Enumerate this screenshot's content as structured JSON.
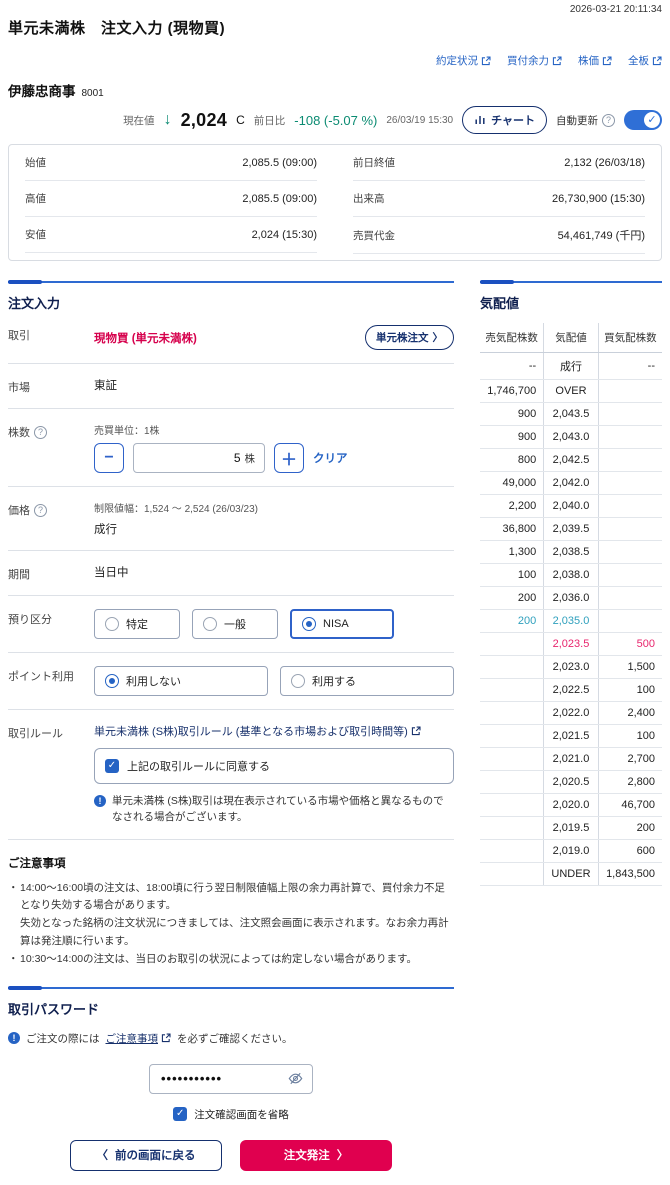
{
  "colors": {
    "accent_blue": "#2e6ad1",
    "link_blue": "#2563c4",
    "navy": "#15306e",
    "crimson": "#d6004c",
    "button_red": "#e0004f",
    "down_green": "#0b8b72",
    "sell_teal": "#2fa0bd",
    "buy_pink": "#e8256d",
    "toggle_blue": "#2f6fd6"
  },
  "header": {
    "timestamp": "2026-03-21 20:11:34",
    "title": "単元未満株　注文入力 (現物買)",
    "links": {
      "executions": "約定状況",
      "buying_power": "買付余力",
      "stock_price": "株価",
      "full_board": "全板"
    }
  },
  "stock": {
    "name": "伊藤忠商事",
    "code": "8001",
    "current_label": "現在値",
    "down_arrow": "↓",
    "price": "2,024",
    "price_flag": "C",
    "change_label": "前日比",
    "change": "-108 (-5.07 %)",
    "quote_time": "26/03/19 15:30",
    "chart_button": "チャート",
    "auto_update": "自動更新",
    "toggle_check": "✓"
  },
  "summary": {
    "open_label": "始値",
    "open": "2,085.5 (09:00)",
    "high_label": "高値",
    "high": "2,085.5 (09:00)",
    "low_label": "安値",
    "low": "2,024 (15:30)",
    "prev_close_label": "前日終値",
    "prev_close": "2,132 (26/03/18)",
    "volume_label": "出来高",
    "volume": "26,730,900 (15:30)",
    "turnover_label": "売買代金",
    "turnover": "54,461,749 (千円)"
  },
  "order": {
    "title": "注文入力",
    "trade_label": "取引",
    "trade_value": "現物買 (単元未満株)",
    "unit_order_button": "単元株注文",
    "market_label": "市場",
    "market_value": "東証",
    "qty_label": "株数",
    "unit_note": "売買単位：1株",
    "minus": "−",
    "plus": "＋",
    "qty": "5",
    "qty_unit": "株",
    "clear": "クリア",
    "price_label": "価格",
    "limit_note": "制限値幅：1,524 ～ 2,524 (26/03/23)",
    "price_value": "成行",
    "period_label": "期間",
    "period_value": "当日中",
    "account_label": "預り区分",
    "account_options": [
      "特定",
      "一般",
      "NISA"
    ],
    "account_selected": "NISA",
    "point_label": "ポイント利用",
    "point_options": [
      "利用しない",
      "利用する"
    ],
    "point_selected": "利用しない",
    "rule_label": "取引ルール",
    "rule_link": "単元未満株 (S株)取引ルール (基準となる市場および取引時間等)",
    "agree_check": "✓",
    "rule_agree": "上記の取引ルールに同意する",
    "info_mark": "!",
    "rule_note": "単元未満株 (S株)取引は現在表示されている市場や価格と異なるものでなされる場合がございます。"
  },
  "notes": {
    "title": "ご注意事項",
    "items": [
      "14:00～16:00頃の注文は、18:00頃に行う翌日制限値幅上限の余力再計算で、買付余力不足となり失効する場合があります。",
      "失効となった銘柄の注文状況につきましては、注文照会画面に表示されます。なお余力再計算は発注順に行います。",
      "10:30～14:00の注文は、当日のお取引の状況によっては約定しない場合があります。"
    ]
  },
  "password": {
    "title": "取引パスワード",
    "info_mark": "!",
    "note_prefix": "ご注文の際には",
    "note_link": "ご注意事項",
    "note_suffix": "を必ずご確認ください。",
    "value": "•••••••••••",
    "skip_check": "✓",
    "skip_confirm": "注文確認画面を省略",
    "back_button": "前の画面に戻る",
    "submit_button": "注文発注"
  },
  "quotes": {
    "title": "気配値",
    "headers": {
      "sell": "売気配株数",
      "price": "気配値",
      "buy": "買気配株数"
    },
    "rows": [
      {
        "sell": "--",
        "price": "成行",
        "buy": "--"
      },
      {
        "sell": "1,746,700",
        "price": "OVER",
        "buy": ""
      },
      {
        "sell": "900",
        "price": "2,043.5",
        "buy": ""
      },
      {
        "sell": "900",
        "price": "2,043.0",
        "buy": ""
      },
      {
        "sell": "800",
        "price": "2,042.5",
        "buy": ""
      },
      {
        "sell": "49,000",
        "price": "2,042.0",
        "buy": ""
      },
      {
        "sell": "2,200",
        "price": "2,040.0",
        "buy": ""
      },
      {
        "sell": "36,800",
        "price": "2,039.5",
        "buy": ""
      },
      {
        "sell": "1,300",
        "price": "2,038.5",
        "buy": ""
      },
      {
        "sell": "100",
        "price": "2,038.0",
        "buy": ""
      },
      {
        "sell": "200",
        "price": "2,036.0",
        "buy": ""
      },
      {
        "sell": "200",
        "price": "2,035.0",
        "buy": ""
      },
      {
        "sell": "",
        "price": "2,023.5",
        "buy": "500"
      },
      {
        "sell": "",
        "price": "2,023.0",
        "buy": "1,500"
      },
      {
        "sell": "",
        "price": "2,022.5",
        "buy": "100"
      },
      {
        "sell": "",
        "price": "2,022.0",
        "buy": "2,400"
      },
      {
        "sell": "",
        "price": "2,021.5",
        "buy": "100"
      },
      {
        "sell": "",
        "price": "2,021.0",
        "buy": "2,700"
      },
      {
        "sell": "",
        "price": "2,020.5",
        "buy": "2,800"
      },
      {
        "sell": "",
        "price": "2,020.0",
        "buy": "46,700"
      },
      {
        "sell": "",
        "price": "2,019.5",
        "buy": "200"
      },
      {
        "sell": "",
        "price": "2,019.0",
        "buy": "600"
      },
      {
        "sell": "",
        "price": "UNDER",
        "buy": "1,843,500"
      }
    ]
  }
}
